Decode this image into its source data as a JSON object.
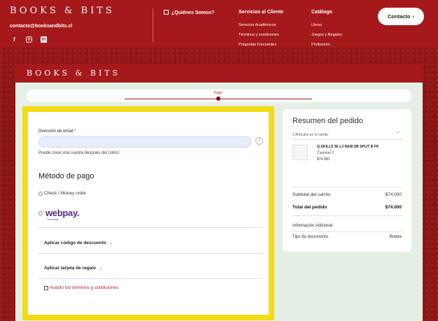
{
  "header": {
    "brand": "BOOKS & BITS",
    "email": "contacto@booksandbits.cl",
    "nav": [
      {
        "heading": "¿Quiénes Somos?",
        "links": []
      },
      {
        "heading": "Servicios al Cliente",
        "links": [
          "Servicios Académicos",
          "Términos y condiciones",
          "Preguntas Frecuentes"
        ]
      },
      {
        "heading": "Catálogo",
        "links": [
          "Libros",
          "Juegos y Regalos",
          "Profesores"
        ]
      }
    ],
    "contact_label": "Contacto",
    "contact_arrow": "›"
  },
  "window": {
    "brand": "BOOKS & BITS"
  },
  "progress": {
    "step_label": "Pago"
  },
  "form": {
    "email_label": "Dirección de email",
    "required_mark": "*",
    "help_icon": "?",
    "account_hint": "Puede crear una cuenta después del cobro.",
    "payment_title": "Método de pago",
    "payment_option_check": "Check / Money order",
    "webpay_logo": "webpay.",
    "webpay_sub": "Transbank",
    "discount_label": "Aplicar código de descuento",
    "giftcard_label": "Aplicar tarjeta de regalo",
    "terms_label": "Acepto los términos y condiciones",
    "chevron": "⌄"
  },
  "summary": {
    "title": "Resumen del pedido",
    "items_count": "2 Artículos en el carrito",
    "chevron": "⌃",
    "product_name": "Q-SKILLS 3E L3 R&W SB SPLIT B FK",
    "product_qty": "Cantidad 2",
    "product_price": "$74.000",
    "subtotal_label": "Subtotal del carrito",
    "subtotal_value": "$74.000",
    "total_label": "Total del pedido",
    "total_value": "$74.000",
    "additional_info": "Información Adicional",
    "doc_type_label": "Tipo de documento",
    "doc_type_value": "Boleta"
  }
}
